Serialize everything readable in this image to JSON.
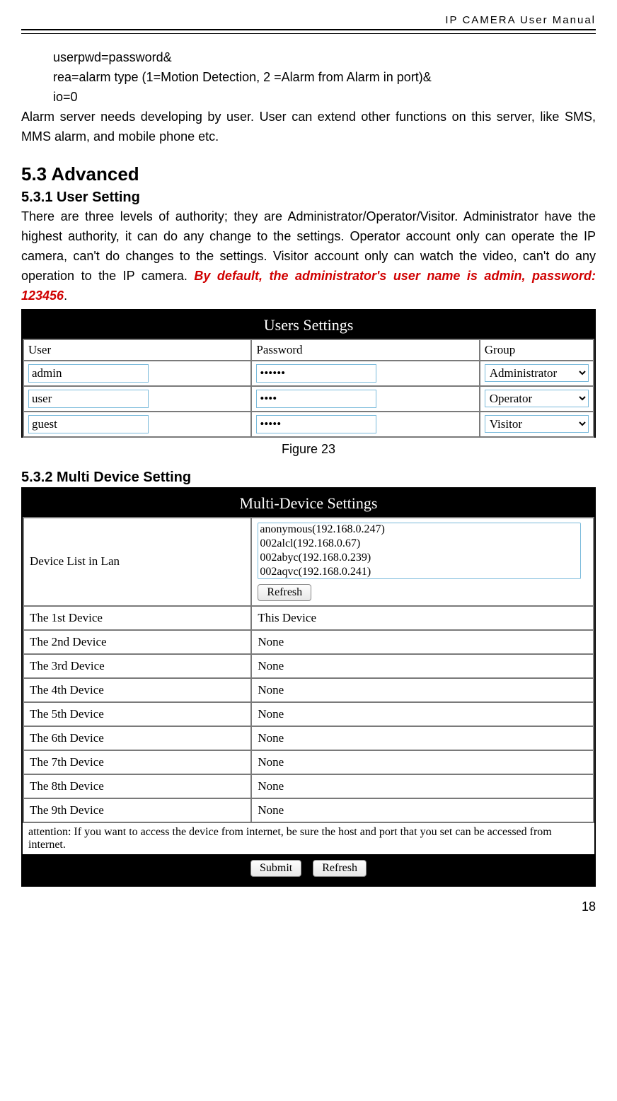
{
  "running_head": "IP  CAMERA  User  Manual",
  "lines": {
    "l1": "userpwd=password&",
    "l2": "rea=alarm type (1=Motion Detection, 2 =Alarm from Alarm in port)&",
    "l3": "io=0"
  },
  "body_p1": "Alarm server needs developing by user. User can extend other functions on this server, like SMS, MMS alarm, and mobile phone etc.",
  "h2": "5.3   Advanced",
  "h3_1": "5.3.1   User Setting",
  "user_setting_p_plain": "There are three levels of authority; they are Administrator/Operator/Visitor. Administrator have the highest authority, it can do any change to the settings. Operator account only can operate the IP camera, can't do changes to the settings. Visitor account only can watch the video, can't do any operation to the IP camera. ",
  "user_setting_p_red": "By default, the administrator's user name is admin, password: 123456",
  "user_setting_p_tail": ".",
  "users_fig": {
    "title": "Users Settings",
    "headers": {
      "user": "User",
      "password": "Password",
      "group": "Group"
    },
    "rows": [
      {
        "user": "admin",
        "password": "••••••",
        "group": "Administrator"
      },
      {
        "user": "user",
        "password": "••••",
        "group": "Operator"
      },
      {
        "user": "guest",
        "password": "•••••",
        "group": "Visitor"
      }
    ],
    "group_options": [
      "Administrator",
      "Operator",
      "Visitor"
    ]
  },
  "fig23_caption": "Figure 23",
  "h3_2": "5.3.2   Multi Device Setting",
  "multi_fig": {
    "title": "Multi-Device Settings",
    "device_list_label": "Device List in Lan",
    "device_list_items": [
      "anonymous(192.168.0.247)",
      "002alcl(192.168.0.67)",
      "002abyc(192.168.0.239)",
      "002aqvc(192.168.0.241)"
    ],
    "refresh_label": "Refresh",
    "rows": [
      {
        "label": "The 1st Device",
        "value": "This Device"
      },
      {
        "label": "The 2nd Device",
        "value": "None"
      },
      {
        "label": "The 3rd Device",
        "value": "None"
      },
      {
        "label": "The 4th Device",
        "value": "None"
      },
      {
        "label": "The 5th Device",
        "value": "None"
      },
      {
        "label": "The 6th Device",
        "value": "None"
      },
      {
        "label": "The 7th Device",
        "value": "None"
      },
      {
        "label": "The 8th Device",
        "value": "None"
      },
      {
        "label": "The 9th Device",
        "value": "None"
      }
    ],
    "attention": "attention: If you want to access the device from internet, be sure the host and port that you set can be accessed from internet.",
    "submit_label": "Submit",
    "refresh2_label": "Refresh"
  },
  "page_number": "18"
}
